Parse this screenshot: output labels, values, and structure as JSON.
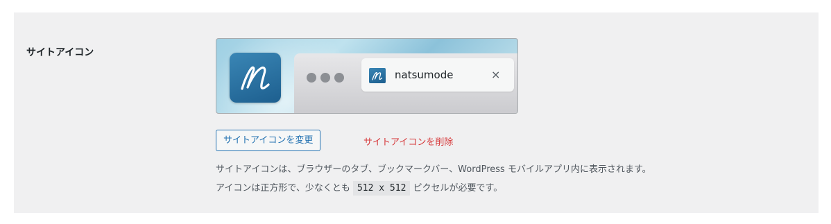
{
  "setting": {
    "label": "サイトアイコン"
  },
  "preview": {
    "site_name": "natsumode",
    "close_glyph": "×",
    "icon_letter": "n"
  },
  "actions": {
    "change_label": "サイトアイコンを変更",
    "remove_label": "サイトアイコンを削除"
  },
  "description": {
    "line1": "サイトアイコンは、ブラウザーのタブ、ブックマークバー、WordPress モバイルアプリ内に表示されます。",
    "line2_prefix": "アイコンは正方形で、少なくとも ",
    "size_code": "512 x 512",
    "line2_suffix": " ピクセルが必要です。"
  },
  "colors": {
    "link": "#2271b1",
    "danger": "#d63638",
    "icon_blue": "#1d5f8f"
  }
}
